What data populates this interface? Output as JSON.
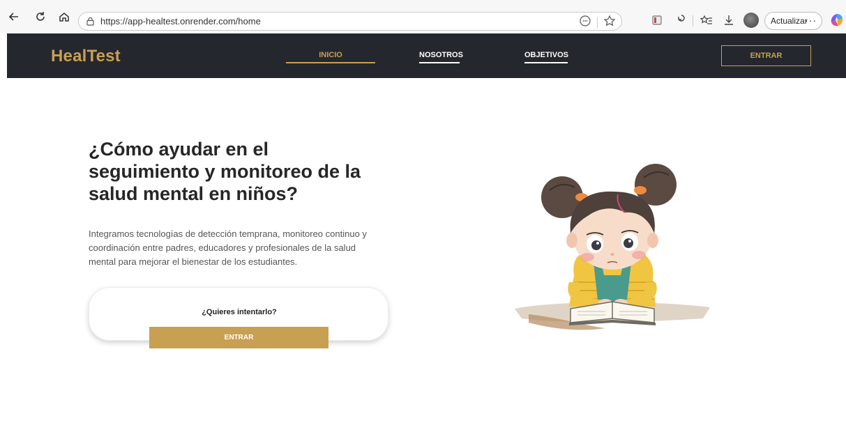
{
  "browser": {
    "url": "https://app-healtest.onrender.com/home",
    "update_label": "Actualizar",
    "more_label": "···"
  },
  "nav": {
    "brand": "HealTest",
    "links": [
      {
        "label": "INICIO",
        "active": true
      },
      {
        "label": "NOSOTROS",
        "active": false
      },
      {
        "label": "OBJETIVOS",
        "active": false
      }
    ],
    "enter_label": "ENTRAR"
  },
  "hero": {
    "title": "¿Cómo ayudar en el seguimiento y monitoreo de la salud mental en niños?",
    "description": "Integramos tecnologías de detección temprana, monitoreo continuo y coordinación entre padres, educadores y profesionales de la salud mental para mejorar el bienestar de los estudiantes.",
    "cta_question": "¿Quieres intentarlo?",
    "cta_button": "ENTRAR"
  },
  "colors": {
    "accent": "#c8a052",
    "nav_bg": "#24272e",
    "text_dark": "#262626"
  }
}
